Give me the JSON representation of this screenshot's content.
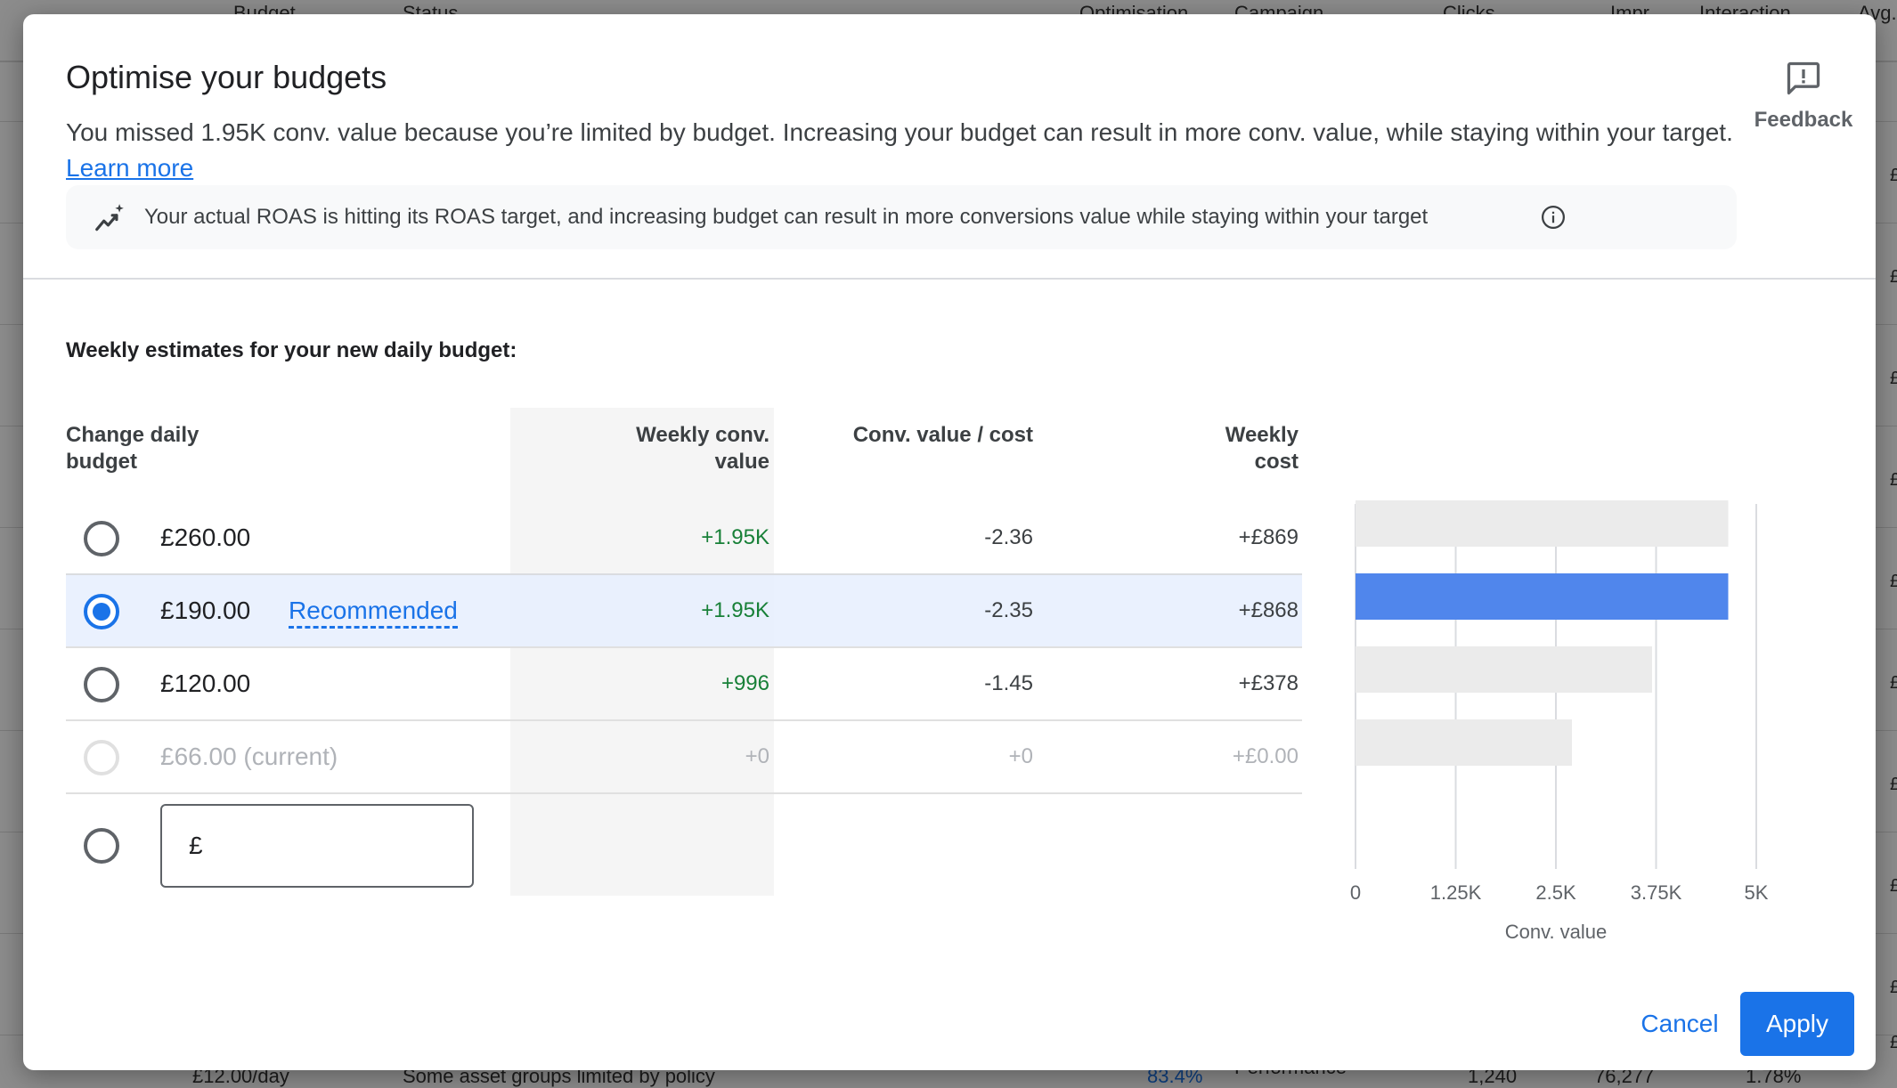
{
  "background": {
    "headers": [
      "Budget",
      "Status",
      "Optimisation",
      "Campaign",
      "Clicks",
      "Impr.",
      "Interaction",
      "Avg."
    ],
    "footer": {
      "budget": "£12.00/day",
      "status": "Some asset groups limited by policy",
      "optimisation": "83.4%",
      "campaign": "Performance",
      "clicks": "1,240",
      "impr": "76,277",
      "interaction": "1.78%"
    },
    "right_col": [
      "£",
      "£",
      "£",
      "£",
      "£",
      "£",
      "£",
      "£",
      "£",
      "£"
    ]
  },
  "dialog": {
    "title": "Optimise your budgets",
    "subtitle": "You missed 1.95K conv. value because you’re limited by budget. Increasing your budget can result in more conv. value, while staying within your target.",
    "learn_more": "Learn more",
    "feedback_label": "Feedback",
    "insight": "Your actual ROAS is hitting its ROAS target, and increasing budget can result in more conversions value while staying within your target",
    "section_title": "Weekly estimates for your new daily budget:",
    "columns": {
      "budget": "Change daily budget",
      "conv_value": "Weekly conv. value",
      "conv_value_cost": "Conv. value / cost",
      "cost": "Weekly cost"
    },
    "rows": [
      {
        "budget": "£260.00",
        "recommended": "",
        "conv_value": "+1.95K",
        "ratio": "-2.36",
        "cost": "+£869"
      },
      {
        "budget": "£190.00",
        "recommended": "Recommended",
        "conv_value": "+1.95K",
        "ratio": "-2.35",
        "cost": "+£868"
      },
      {
        "budget": "£120.00",
        "recommended": "",
        "conv_value": "+996",
        "ratio": "-1.45",
        "cost": "+£378"
      },
      {
        "budget": "£66.00 (current)",
        "recommended": "",
        "conv_value": "+0",
        "ratio": "+0",
        "cost": "+£0.00"
      }
    ],
    "selected_row": 1,
    "custom_currency": "£",
    "cancel_label": "Cancel",
    "apply_label": "Apply"
  },
  "colors": {
    "accent": "#1a73e8",
    "selected_bar": "#5086ec",
    "bar": "#ebebeb",
    "positive": "#188038"
  },
  "chart_data": {
    "type": "bar",
    "orientation": "horizontal",
    "categories": [
      "£260.00",
      "£190.00",
      "£120.00",
      "£66.00 (current)"
    ],
    "values": [
      4650,
      4650,
      3700,
      2700
    ],
    "highlighted_index": 1,
    "xlabel": "Conv. value",
    "xlim": [
      0,
      5000
    ],
    "xticks": [
      "0",
      "1.25K",
      "2.5K",
      "3.75K",
      "5K"
    ],
    "xtick_values": [
      0,
      1250,
      2500,
      3750,
      5000
    ],
    "grid": true
  }
}
